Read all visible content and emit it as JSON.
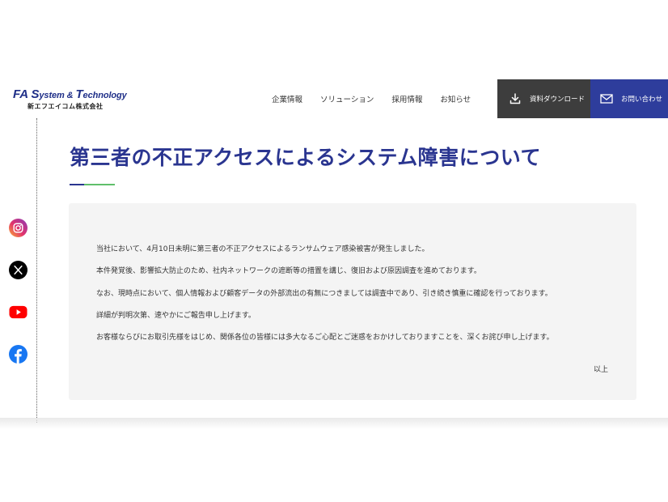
{
  "header": {
    "logo": {
      "name_parts": [
        "F",
        "A ",
        "S",
        "ystem & ",
        "T",
        "echnology"
      ],
      "subtitle": "新エフエイコム株式会社"
    },
    "nav": [
      {
        "label": "企業情報"
      },
      {
        "label": "ソリューション"
      },
      {
        "label": "採用情報"
      },
      {
        "label": "お知らせ"
      }
    ],
    "download_button": {
      "label": "資料ダウンロード",
      "icon": "download-icon"
    },
    "contact_button": {
      "label": "お問い合わせ",
      "icon": "mail-icon"
    }
  },
  "sidebar": {
    "social": [
      {
        "name": "instagram",
        "icon": "instagram-icon"
      },
      {
        "name": "x",
        "icon": "x-icon"
      },
      {
        "name": "youtube",
        "icon": "youtube-icon"
      },
      {
        "name": "facebook",
        "icon": "facebook-icon"
      }
    ]
  },
  "article": {
    "title": "第三者の不正アクセスによるシステム障害について",
    "paragraphs": [
      "当社において、4月10日未明に第三者の不正アクセスによるランサムウェア感染被害が発生しました。",
      "本件発覚後、影響拡大防止のため、社内ネットワークの遮断等の措置を講じ、復旧および原因調査を進めております。",
      "なお、現時点において、個人情報および顧客データの外部流出の有無につきましては調査中であり、引き続き慎重に確認を行っております。",
      "詳細が判明次第、速やかにご報告申し上げます。",
      "お客様ならびにお取引先様をはじめ、関係各位の皆様には多大なるご心配とご迷惑をおかけしておりますことを、深くお詫び申し上げます。"
    ],
    "closing": "以上"
  },
  "colors": {
    "brand_navy": "#2a3590",
    "contact_blue": "#2e3d9c",
    "download_dark": "#3d3d3d",
    "accent_green": "#5fbf6a",
    "notice_bg": "#f4f4f4"
  }
}
